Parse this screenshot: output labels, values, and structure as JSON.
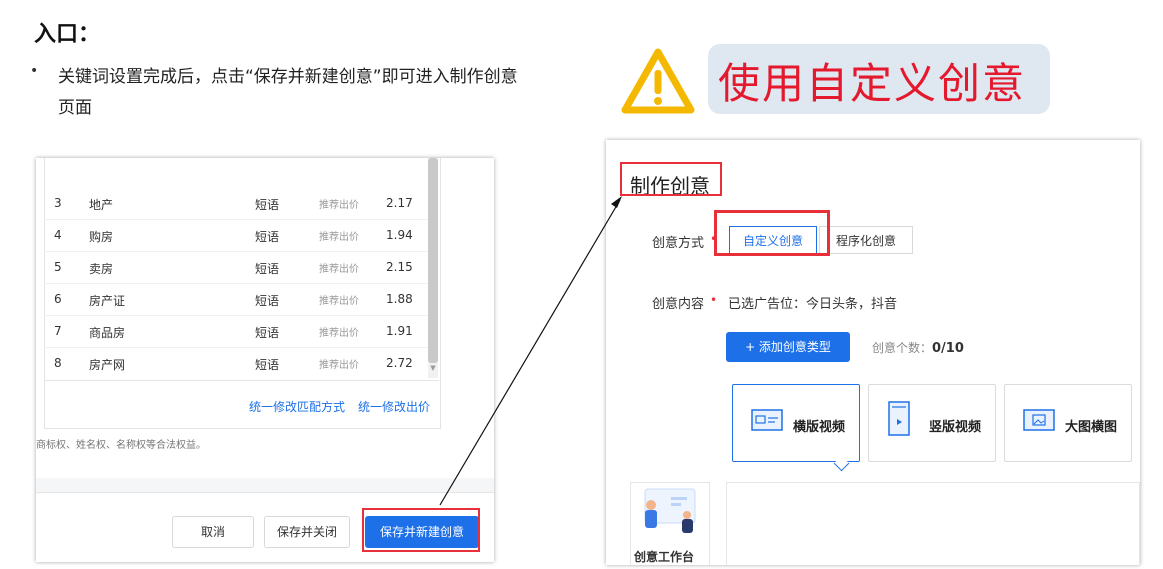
{
  "heading": "入口：",
  "bullet": {
    "dot": "•",
    "text": "关键词设置完成后，点击“保存并新建创意”即可进入制作创意页面"
  },
  "warning": {
    "text": "使用自定义创意",
    "icon": "warning-triangle-icon",
    "icon_color": "#f5b800",
    "text_color": "#e5192e"
  },
  "left_screen": {
    "rows": [
      {
        "num": "3",
        "word": "地产",
        "type": "短语",
        "bid_label": "推荐出价",
        "bid": "2.17"
      },
      {
        "num": "4",
        "word": "购房",
        "type": "短语",
        "bid_label": "推荐出价",
        "bid": "1.94"
      },
      {
        "num": "5",
        "word": "卖房",
        "type": "短语",
        "bid_label": "推荐出价",
        "bid": "2.15"
      },
      {
        "num": "6",
        "word": "房产证",
        "type": "短语",
        "bid_label": "推荐出价",
        "bid": "1.88"
      },
      {
        "num": "7",
        "word": "商品房",
        "type": "短语",
        "bid_label": "推荐出价",
        "bid": "1.91"
      },
      {
        "num": "8",
        "word": "房产网",
        "type": "短语",
        "bid_label": "推荐出价",
        "bid": "2.72"
      }
    ],
    "link_match": "统一修改匹配方式",
    "link_bid": "统一修改出价",
    "legal": "商标权、姓名权、名称权等合法权益。",
    "cancel": "取消",
    "save_close": "保存并关闭",
    "save_new": "保存并新建创意",
    "accent": "#1e70e8",
    "highlight": "#e8303a"
  },
  "right_screen": {
    "title": "制作创意",
    "method_label": "创意方式",
    "required_mark": "•",
    "option_custom": "自定义创意",
    "option_programmatic": "程序化创意",
    "content_label": "创意内容",
    "selected_slots": "已选广告位：今日头条，抖音",
    "add_button": "+ 添加创意类型",
    "count_label": "创意个数：",
    "count_value": "0/10",
    "cards": [
      {
        "label": "横版视频",
        "icon": "horizontal-video-icon"
      },
      {
        "label": "竖版视频",
        "icon": "vertical-video-icon"
      },
      {
        "label": "大图横图",
        "icon": "large-image-icon"
      }
    ],
    "workbench": "创意工作台"
  }
}
